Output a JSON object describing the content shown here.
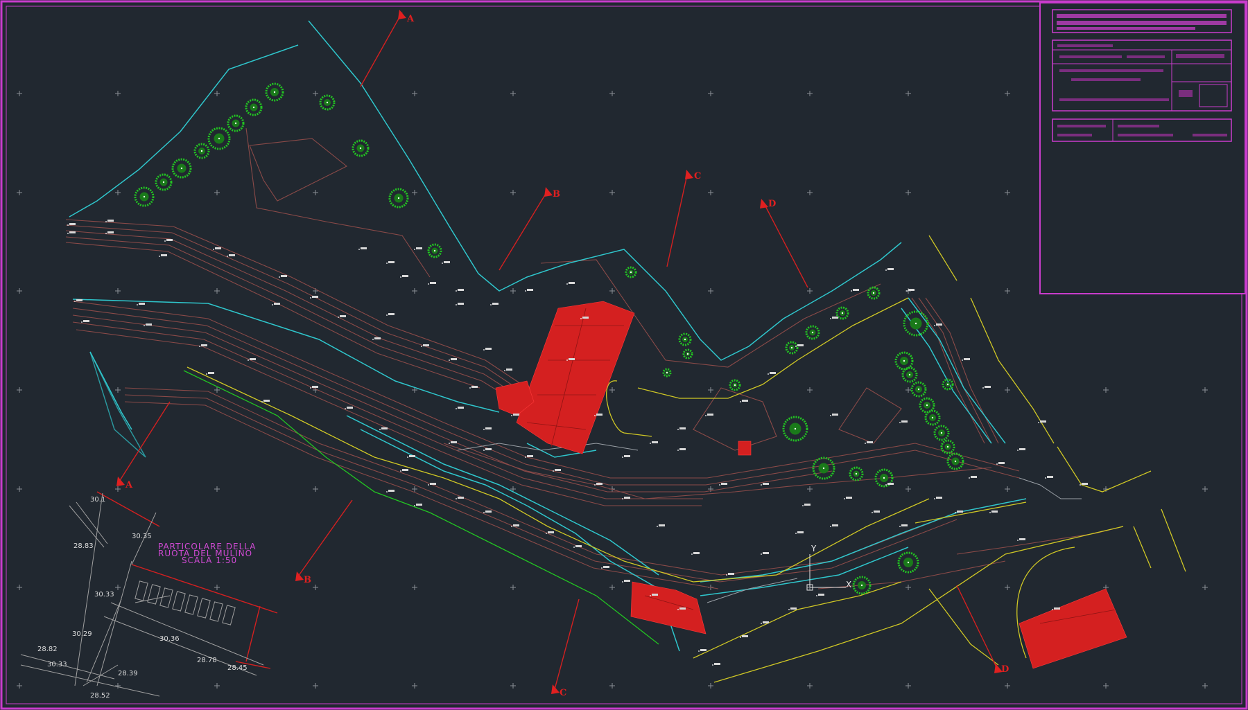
{
  "colors": {
    "background": "#212830",
    "frame": "#c93ccc",
    "contour": "#8a4a48",
    "road_edge": "#2fc6cc",
    "path": "#cfc725",
    "buildings": "#d42020",
    "trees": "#22c522",
    "section_lines": "#d42020",
    "detail": "#a0a0a0"
  },
  "section_markers": [
    {
      "id": "sec-A-top",
      "label": "A"
    },
    {
      "id": "sec-A-bottom",
      "label": "A"
    },
    {
      "id": "sec-B-top",
      "label": "B"
    },
    {
      "id": "sec-B-bottom",
      "label": "B"
    },
    {
      "id": "sec-C-top",
      "label": "C"
    },
    {
      "id": "sec-C-bottom",
      "label": "C"
    },
    {
      "id": "sec-D-top",
      "label": "D"
    },
    {
      "id": "sec-D-bottom",
      "label": "D"
    }
  ],
  "detail": {
    "title_line1": "PARTICOLARE DELLA",
    "title_line2": "RUOTA DEL MULINO",
    "title_line3": "SCALA 1:50",
    "elevations": [
      "30.1",
      "28.83",
      "30.35",
      "30.33",
      "30.29",
      "30.36",
      "28.82",
      "30.33",
      "28.78",
      "28.45",
      "28.39",
      "28.52"
    ]
  },
  "ucs": {
    "x_label": "X",
    "y_label": "Y"
  },
  "title_block": {
    "description": "illegible title block"
  }
}
